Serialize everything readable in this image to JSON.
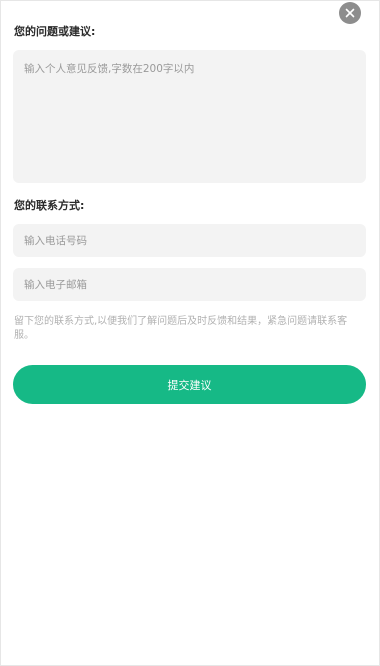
{
  "feedback": {
    "issue_label": "您的问题或建议:",
    "issue_placeholder": "输入个人意见反馈,字数在200字以内",
    "contact_label": "您的联系方式:",
    "phone_placeholder": "输入电话号码",
    "email_placeholder": "输入电子邮箱",
    "hint": "留下您的联系方式,以便我们了解问题后及时反馈和结果，紧急问题请联系客服。",
    "submit_label": "提交建议"
  },
  "icons": {
    "close": "close-icon"
  },
  "colors": {
    "accent": "#16b986",
    "field_background": "#f3f3f3",
    "close_background": "#8d8d8d"
  }
}
